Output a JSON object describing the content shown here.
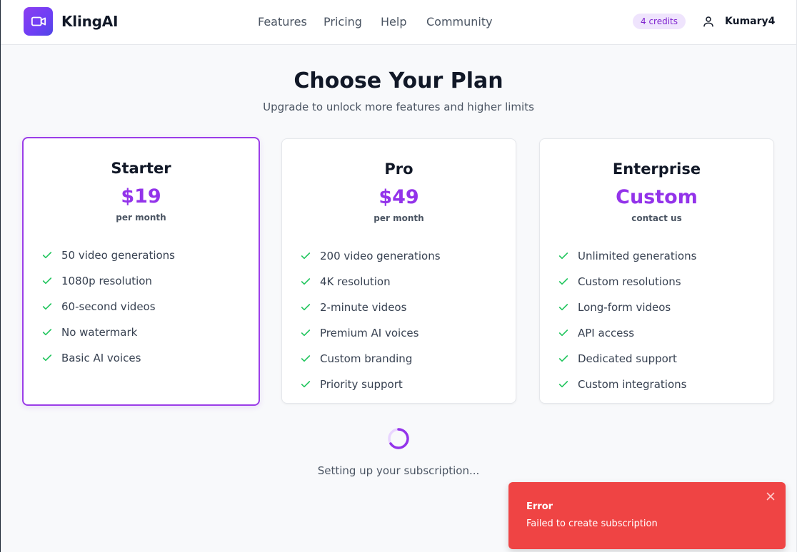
{
  "app": {
    "name": "KlingAI",
    "logo_icon": "video-camera-icon",
    "brand_color": "#9333ea"
  },
  "nav": {
    "items": [
      "Features",
      "Pricing",
      "Help",
      "Community"
    ]
  },
  "account": {
    "credits_label": "4 credits",
    "user_icon": "user-icon",
    "username": "Kumary4"
  },
  "page": {
    "title": "Choose Your Plan",
    "subtitle": "Upgrade to unlock more features and higher limits"
  },
  "plans": [
    {
      "name": "Starter",
      "price": "$19",
      "period": "per month",
      "selected": true,
      "features": [
        "50 video generations",
        "1080p resolution",
        "60-second videos",
        "No watermark",
        "Basic AI voices"
      ]
    },
    {
      "name": "Pro",
      "price": "$49",
      "period": "per month",
      "selected": false,
      "features": [
        "200 video generations",
        "4K resolution",
        "2-minute videos",
        "Premium AI voices",
        "Custom branding",
        "Priority support"
      ]
    },
    {
      "name": "Enterprise",
      "price": "Custom",
      "period": "contact us",
      "selected": false,
      "features": [
        "Unlimited generations",
        "Custom resolutions",
        "Long-form videos",
        "API access",
        "Dedicated support",
        "Custom integrations"
      ]
    }
  ],
  "loading": {
    "text": "Setting up your subscription..."
  },
  "toast": {
    "title": "Error",
    "message": "Failed to create subscription",
    "color": "#ef4444"
  },
  "colors": {
    "check": "#22c55e",
    "accent": "#9333ea",
    "credits_bg": "#efe4fd"
  }
}
